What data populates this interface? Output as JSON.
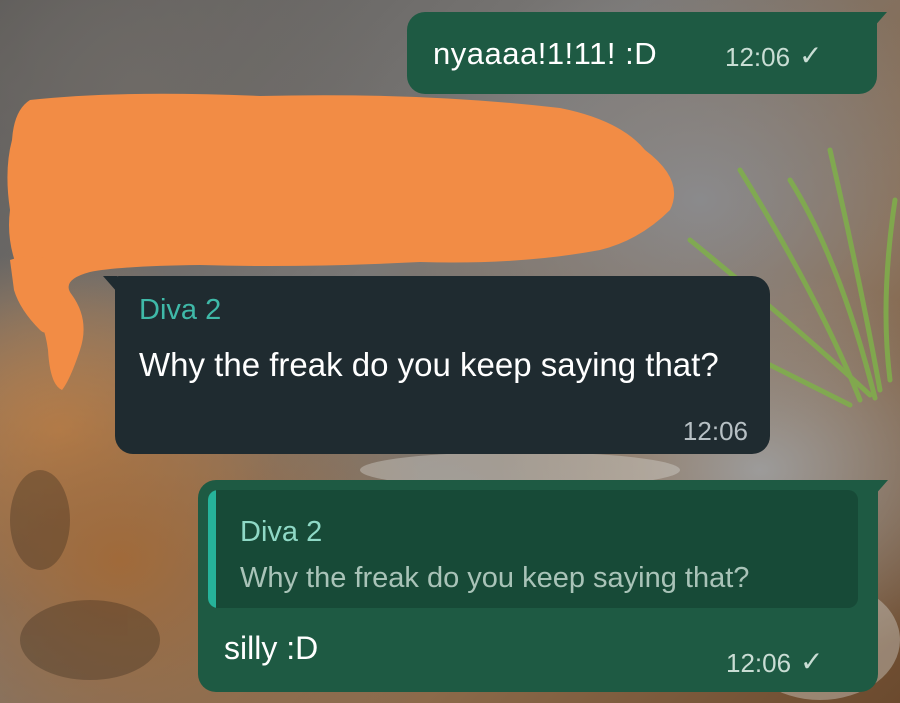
{
  "chat": {
    "messages": [
      {
        "direction": "outgoing",
        "text": "nyaaaa!1!11! :D",
        "time": "12:06",
        "status_icon": "single-check-icon"
      },
      {
        "direction": "incoming",
        "sender": "Diva 2",
        "text": "Why the freak do you keep saying that?",
        "time": "12:06"
      },
      {
        "direction": "outgoing",
        "reply_to": {
          "sender": "Diva 2",
          "text": "Why the freak do you keep saying that?"
        },
        "text": "silly :D",
        "time": "12:06",
        "status_icon": "single-check-icon"
      }
    ],
    "tick_glyph": "✓",
    "colors": {
      "outgoing_bubble": "#1e5a43",
      "incoming_bubble": "#1f2b30",
      "sender_name": "#3fb9a8",
      "quote_bar": "#26b39a",
      "redaction": "#f28c45"
    }
  }
}
